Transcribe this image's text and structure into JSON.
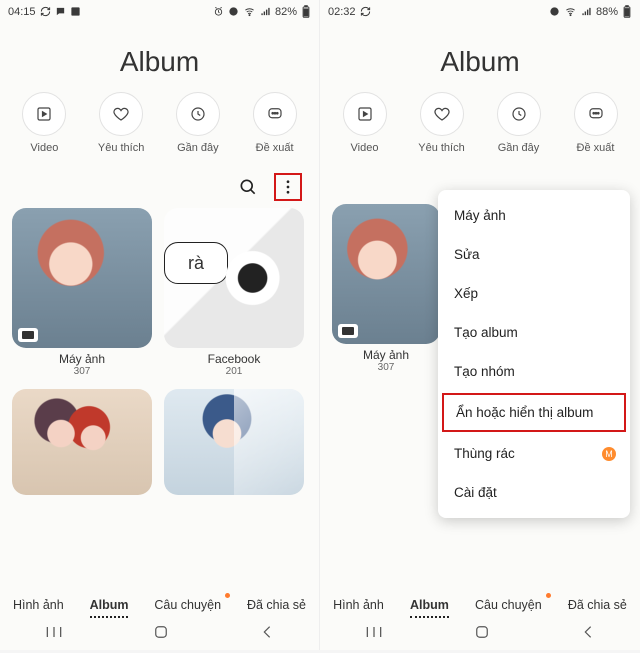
{
  "left": {
    "statusbar": {
      "time": "04:15",
      "battery": "82%"
    },
    "title": "Album",
    "chips": [
      {
        "label": "Video"
      },
      {
        "label": "Yêu thích"
      },
      {
        "label": "Gần đây"
      },
      {
        "label": "Đề xuất"
      }
    ],
    "albums": [
      {
        "name": "Máy ảnh",
        "count": "307"
      },
      {
        "name": "Facebook",
        "count": "201",
        "bubble": "rà"
      }
    ],
    "tabs": [
      {
        "label": "Hình ảnh"
      },
      {
        "label": "Album",
        "active": true
      },
      {
        "label": "Câu chuyện",
        "dot": true
      },
      {
        "label": "Đã chia sẻ"
      }
    ]
  },
  "right": {
    "statusbar": {
      "time": "02:32",
      "battery": "88%"
    },
    "title": "Album",
    "chips": [
      {
        "label": "Video"
      },
      {
        "label": "Yêu thích"
      },
      {
        "label": "Gần đây"
      },
      {
        "label": "Đề xuất"
      }
    ],
    "albums": [
      {
        "name": "Máy ảnh",
        "count": "307"
      }
    ],
    "menu": [
      {
        "label": "Máy ảnh"
      },
      {
        "label": "Sửa"
      },
      {
        "label": "Xếp"
      },
      {
        "label": "Tạo album"
      },
      {
        "label": "Tạo nhóm"
      },
      {
        "label": "Ẩn hoặc hiển thị album",
        "highlight": true
      },
      {
        "label": "Thùng rác",
        "badge": "M"
      },
      {
        "label": "Cài đặt"
      }
    ],
    "tabs": [
      {
        "label": "Hình ảnh"
      },
      {
        "label": "Album",
        "active": true
      },
      {
        "label": "Câu chuyện",
        "dot": true
      },
      {
        "label": "Đã chia sẻ"
      }
    ]
  }
}
